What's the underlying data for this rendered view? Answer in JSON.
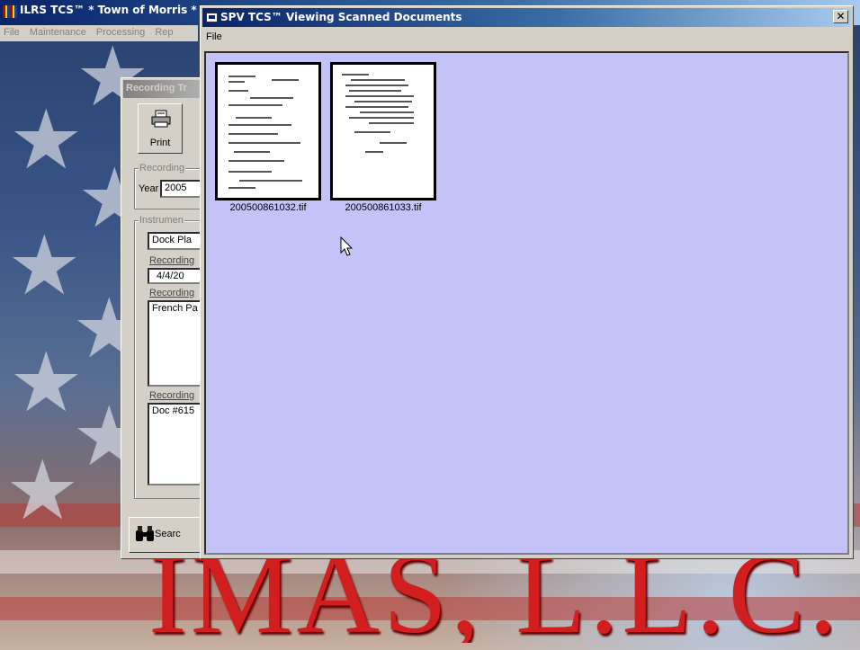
{
  "main_window": {
    "title": "ILRS TCS™ * Town of Morris *",
    "menu": [
      "File",
      "Maintenance",
      "Processing",
      "Rep"
    ]
  },
  "background": {
    "banner_text": "IMAS, L.L.C."
  },
  "recording_dialog": {
    "title": "Recording Tr",
    "print_label": "Print",
    "recording_group_label": "Recording",
    "year_label": "Year",
    "year_value": "2005",
    "instrument_group_label": "Instrumen",
    "instrument_value": "Dock Pla",
    "recording_date_label": "Recording",
    "recording_date_value": "4/4/20",
    "recording_party_label": "Recording",
    "recording_party_value": "French Pa",
    "recording_note_label": "Recording",
    "recording_note_value": "Doc #615",
    "search_label": "Searc"
  },
  "viewer": {
    "title": "SPV TCS™ Viewing Scanned Documents",
    "close_glyph": "✕",
    "menu": [
      "File"
    ],
    "content_bg": "#c4c3f7",
    "documents": [
      {
        "filename": "200500861032.tif"
      },
      {
        "filename": "200500861033.tif"
      }
    ]
  },
  "colors": {
    "titlebar_active": "#0a246a",
    "banner_red": "#d21e1e"
  }
}
